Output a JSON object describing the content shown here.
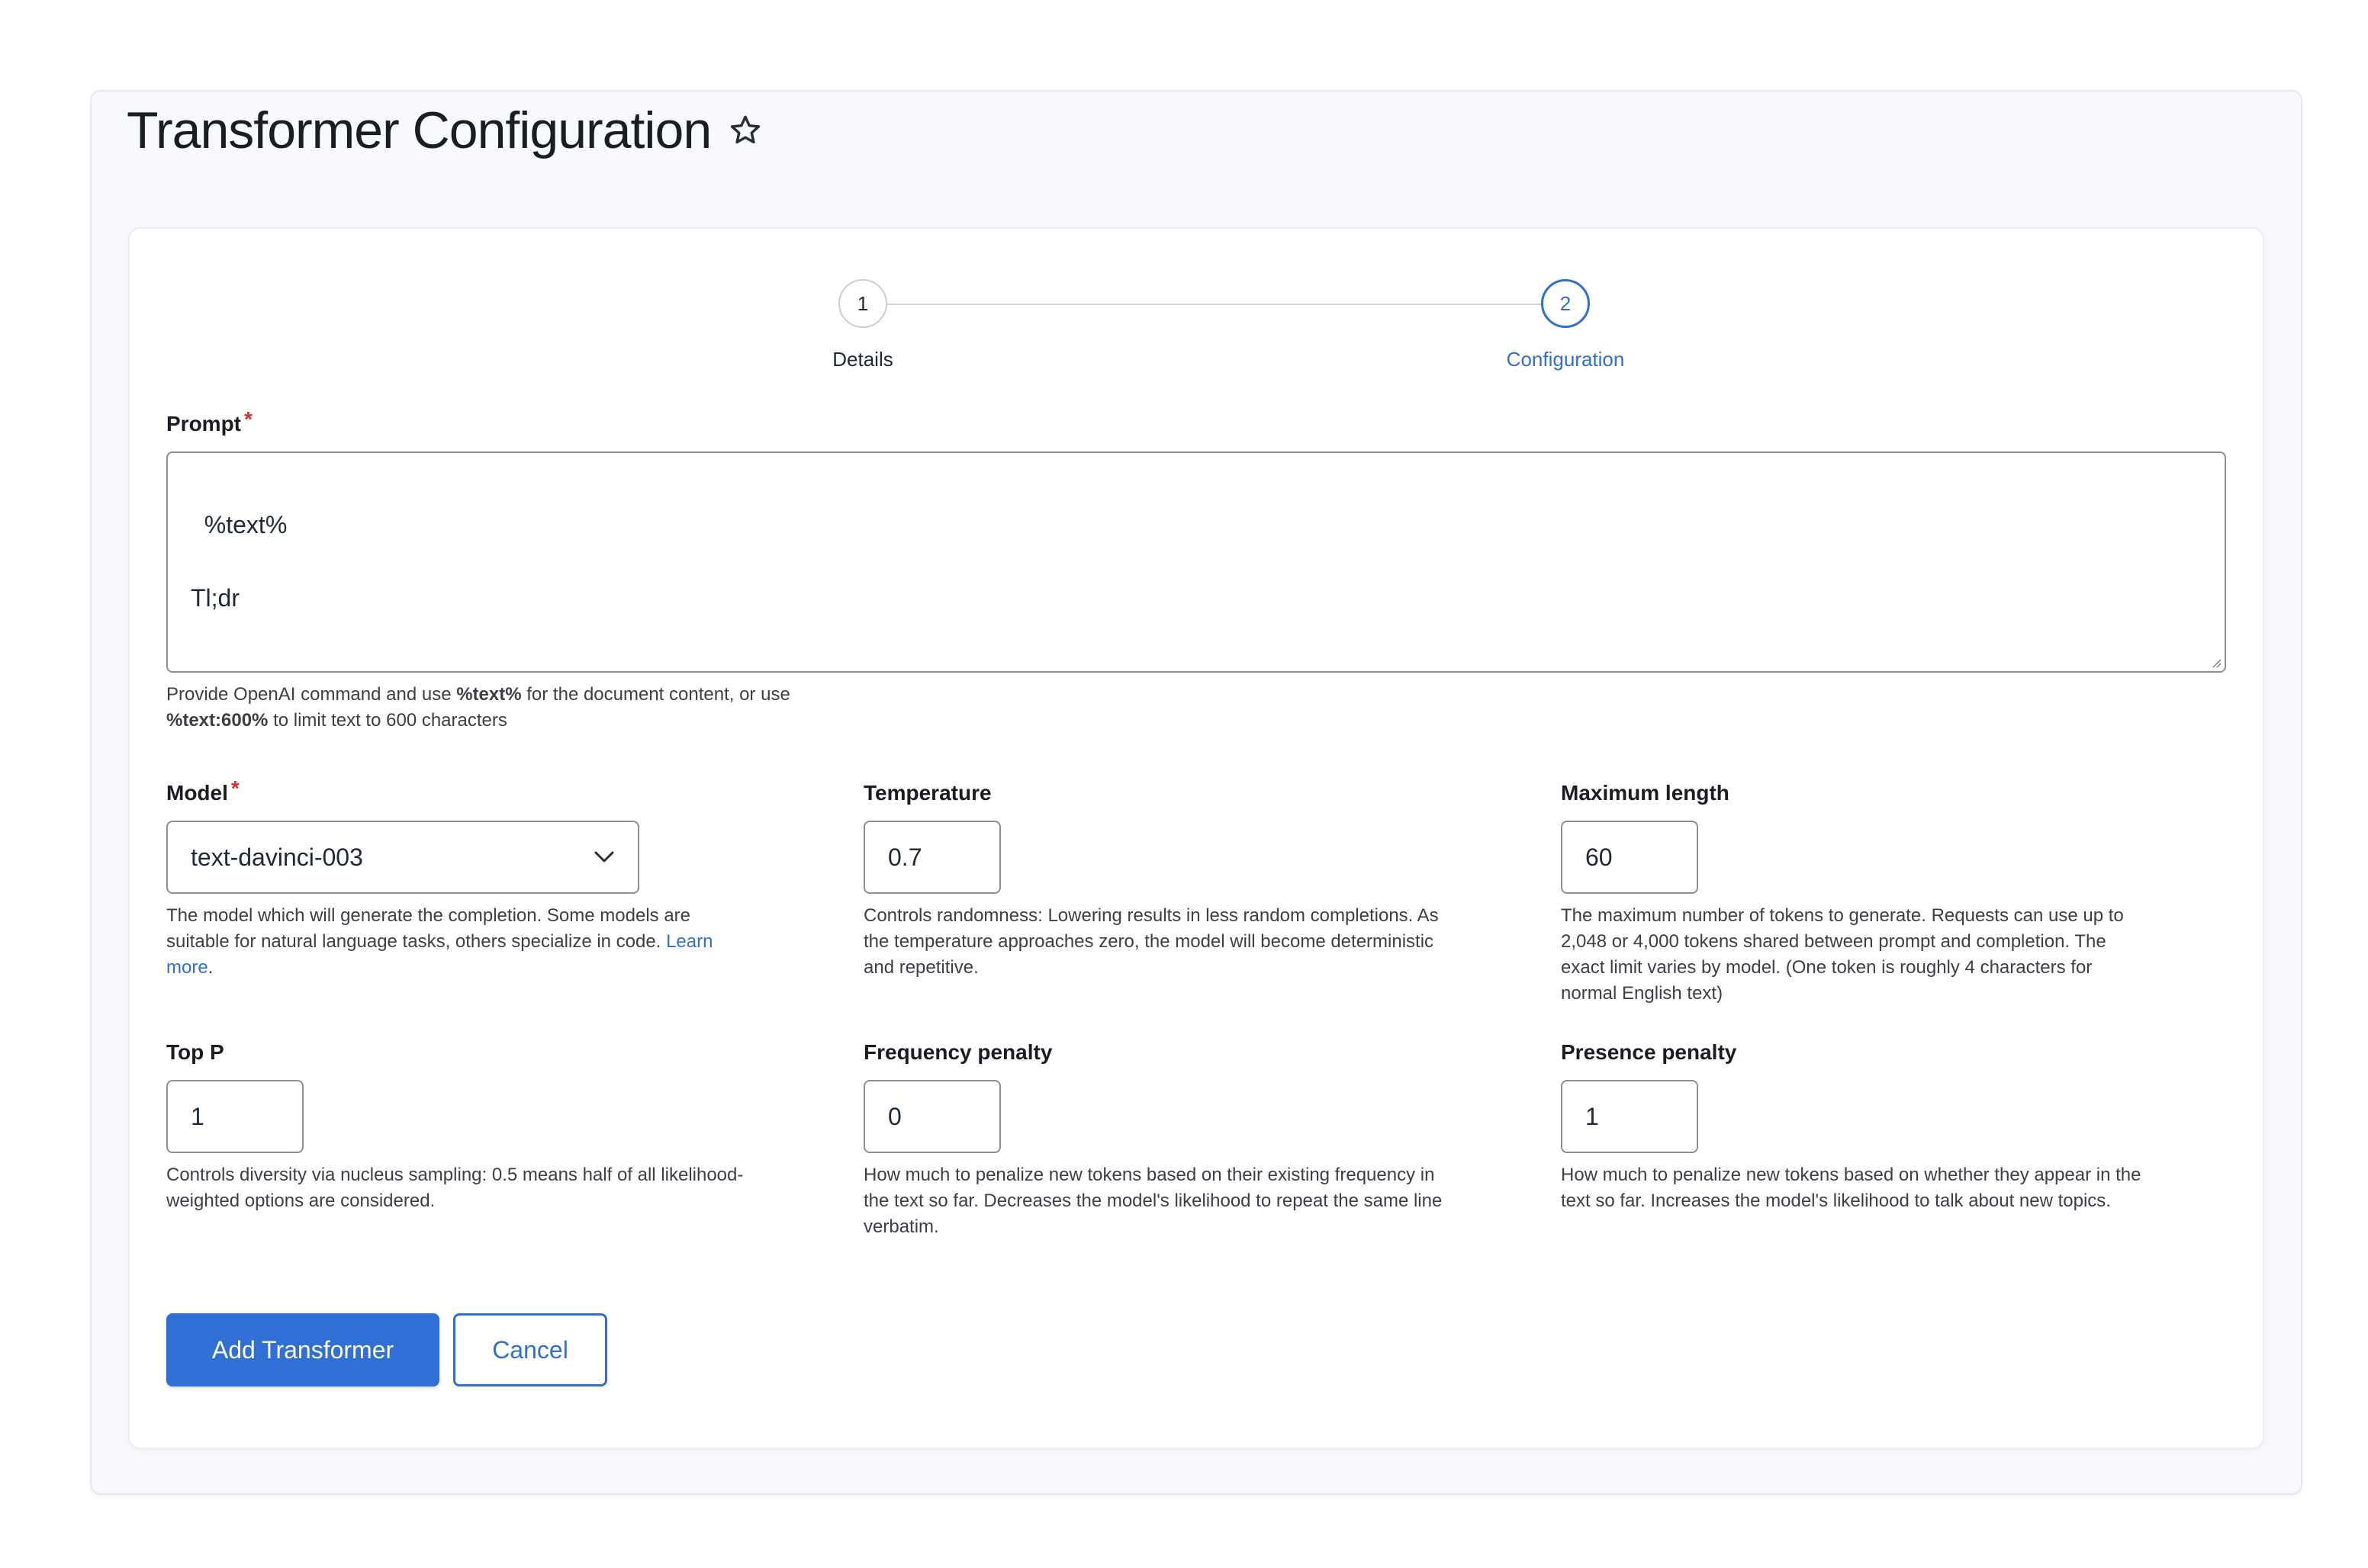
{
  "page": {
    "title": "Transformer Configuration",
    "favorite_icon": "star-icon"
  },
  "stepper": {
    "steps": [
      {
        "number": "1",
        "label": "Details",
        "state": "completed"
      },
      {
        "number": "2",
        "label": "Configuration",
        "state": "active"
      }
    ]
  },
  "prompt": {
    "label": "Prompt",
    "required_mark": "*",
    "value": "%text%\n\nTl;dr",
    "help_line1_a": "Provide OpenAI command and use ",
    "help_line1_bold": "%text%",
    "help_line1_b": " for the document content, or use",
    "help_line2_bold": "%text:600%",
    "help_line2_b": " to limit text to 600 characters"
  },
  "model": {
    "label": "Model",
    "required_mark": "*",
    "value": "text-davinci-003",
    "help_line1": "The model which will generate the completion. Some models are",
    "help_line2_a": "suitable for natural language tasks, others specialize in code. ",
    "help_link_a": "Learn",
    "help_link_b": "more",
    "help_line3_b": "."
  },
  "temperature": {
    "label": "Temperature",
    "value": "0.7",
    "help_line1": "Controls randomness: Lowering results in less random completions. As",
    "help_line2": "the temperature approaches zero, the model will become deterministic",
    "help_line3": "and repetitive."
  },
  "max_length": {
    "label": "Maximum length",
    "value": "60",
    "help_line1": "The maximum number of tokens to generate. Requests can use up to",
    "help_line2": "2,048 or 4,000 tokens shared between prompt and completion. The",
    "help_line3": "exact limit varies by model. (One token is roughly 4 characters for",
    "help_line4": "normal English text)"
  },
  "top_p": {
    "label": "Top P",
    "value": "1",
    "help_line1": "Controls diversity via nucleus sampling: 0.5 means half of all likelihood-",
    "help_line2": "weighted options are considered."
  },
  "frequency_penalty": {
    "label": "Frequency penalty",
    "value": "0",
    "help_line1": "How much to penalize new tokens based on their existing frequency in",
    "help_line2": "the text so far. Decreases the model's likelihood to repeat the same line",
    "help_line3": "verbatim."
  },
  "presence_penalty": {
    "label": "Presence penalty",
    "value": "1",
    "help_line1": "How much to penalize new tokens based on whether they appear in the",
    "help_line2": "text so far. Increases the model's likelihood to talk about new topics."
  },
  "actions": {
    "submit_label": "Add Transformer",
    "cancel_label": "Cancel"
  },
  "colors": {
    "accent": "#2f6fd6",
    "required": "#d2342c",
    "panel_bg": "#f8f9fc"
  }
}
